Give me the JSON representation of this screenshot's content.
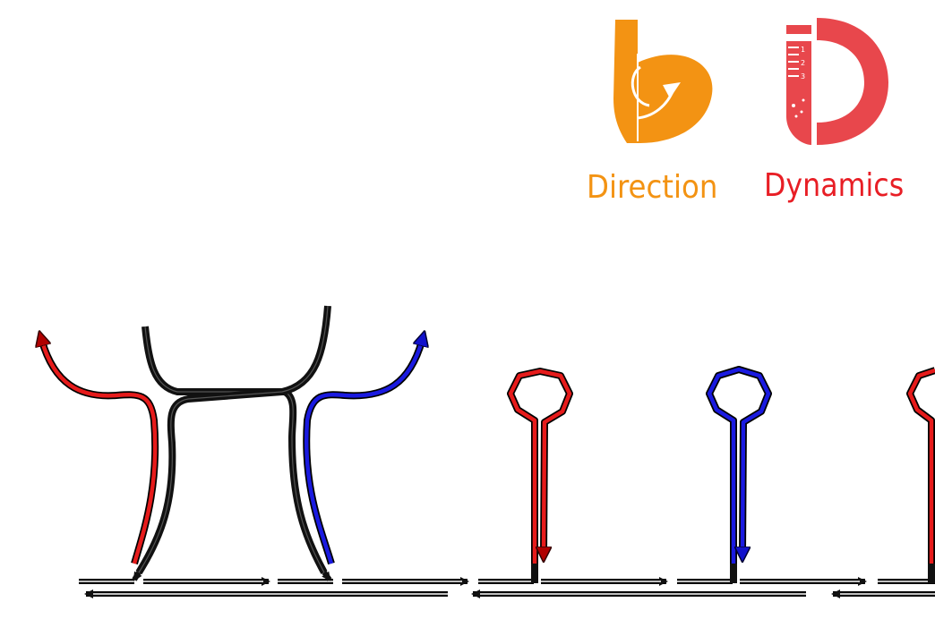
{
  "logos": {
    "direction": {
      "label": "Direction",
      "color": "#f39313",
      "icon": "direction-arrow-icon"
    },
    "dynamics": {
      "label": "Dynamics",
      "color": "#e8474c",
      "label_color": "#e81e25",
      "icon": "dynamics-test-tube-icon",
      "tube_marks": [
        "1",
        "2",
        "3"
      ]
    }
  },
  "diagram": {
    "strand_colors": {
      "template": "#111111",
      "invading_left": "#e61b1b",
      "invading_right": "#1a1ae0",
      "hairpin_red": "#e61b1b",
      "hairpin_blue": "#1a1ae0"
    },
    "hairpins": [
      "red",
      "blue",
      "red"
    ]
  }
}
